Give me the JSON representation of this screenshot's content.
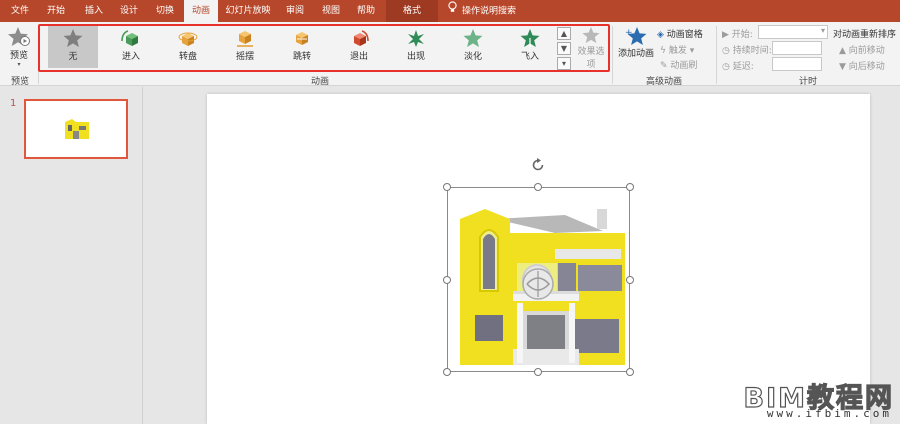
{
  "tabs": [
    {
      "label": "文件"
    },
    {
      "label": "开始"
    },
    {
      "label": "插入"
    },
    {
      "label": "设计"
    },
    {
      "label": "切换"
    },
    {
      "label": "动画"
    },
    {
      "label": "幻灯片放映"
    },
    {
      "label": "审阅"
    },
    {
      "label": "视图"
    },
    {
      "label": "帮助"
    },
    {
      "label": "格式"
    }
  ],
  "tell_me": "操作说明搜索",
  "ribbon": {
    "preview": {
      "button": "预览",
      "group": "预览"
    },
    "animation_group": "动画",
    "animations": [
      {
        "label": "无",
        "icon": "star-gray-icon",
        "color": "#7f7f7f"
      },
      {
        "label": "进入",
        "icon": "cube-enter-icon",
        "color": "#4a9a58"
      },
      {
        "label": "转盘",
        "icon": "cube-spin-icon",
        "color": "#e6a23c"
      },
      {
        "label": "摇摆",
        "icon": "cube-swing-icon",
        "color": "#e6a23c"
      },
      {
        "label": "跳转",
        "icon": "cube-jump-icon",
        "color": "#e6a23c"
      },
      {
        "label": "退出",
        "icon": "cube-exit-icon",
        "color": "#d24a2e"
      },
      {
        "label": "出现",
        "icon": "burst-star-icon",
        "color": "#2e8b57"
      },
      {
        "label": "淡化",
        "icon": "star-fade-icon",
        "color": "#4aa36b"
      },
      {
        "label": "飞入",
        "icon": "star-fly-icon",
        "color": "#2e8b57"
      }
    ],
    "effect_options": "效果选项",
    "advanced": {
      "add_animation": "添加动画",
      "animation_pane": "动画窗格",
      "trigger": "触发",
      "animation_painter": "动画刷",
      "group": "高级动画"
    },
    "timing": {
      "start": "开始:",
      "duration": "持续时间:",
      "delay": "延迟:",
      "group": "计时",
      "reorder_title": "对动画重新排序",
      "move_earlier": "向前移动",
      "move_later": "向后移动"
    }
  },
  "slides": {
    "number": "1"
  },
  "watermark": {
    "main": "BIM教程网",
    "sub": "www.ifbim.com"
  },
  "colors": {
    "accent": "#b7472a",
    "highlight": "#e8302c",
    "building": "#f0e020"
  }
}
